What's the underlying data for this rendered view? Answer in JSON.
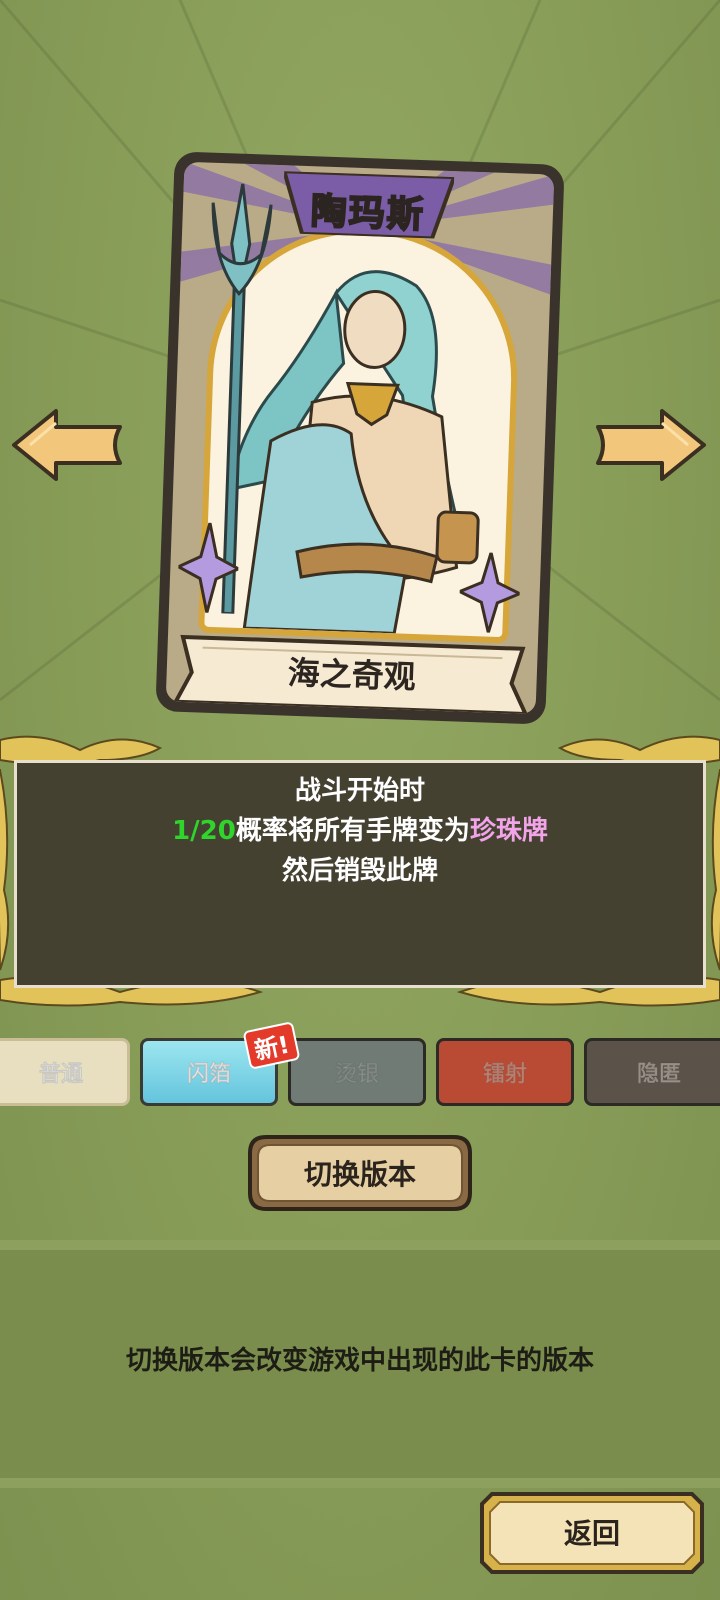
{
  "card": {
    "name": "陶玛斯",
    "title": "海之奇观"
  },
  "description": {
    "line1": "战斗开始时",
    "line2_prob": "1/20",
    "line2_mid": "概率将所有手牌变为",
    "line2_highlight": "珍珠牌",
    "line3": "然后销毁此牌"
  },
  "versions": [
    {
      "label": "普通"
    },
    {
      "label": "闪箔"
    },
    {
      "label": "烫银"
    },
    {
      "label": "镭射"
    },
    {
      "label": "隐匿"
    }
  ],
  "new_badge": "新!",
  "switch_button": "切换版本",
  "info": "切换版本会改变游戏中出现的此卡的版本",
  "back_button": "返回",
  "colors": {
    "background": "#879c57",
    "panel": "#444131",
    "probability": "#2fd52c",
    "highlight": "#f1a4e8",
    "gold": "#d6a63a"
  },
  "icons": [
    "arrow-left-icon",
    "arrow-right-icon",
    "trident-icon",
    "sparkle-icon"
  ]
}
